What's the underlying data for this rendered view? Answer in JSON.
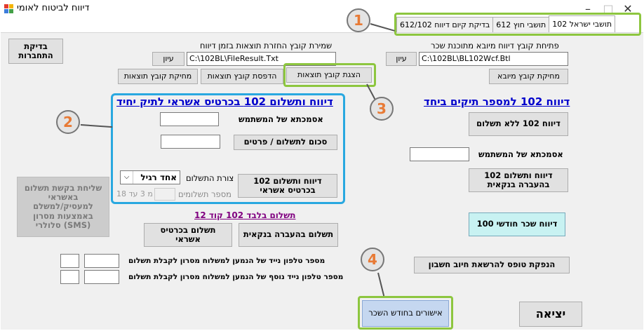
{
  "window": {
    "title": "דיווח לביטוח לאומי"
  },
  "tabs": [
    {
      "label": "612/102 בדיקת קיום דיווח",
      "active": false
    },
    {
      "label": "612 תושבי חוץ",
      "active": false
    },
    {
      "label": "102 תושבי ישראל",
      "active": true
    }
  ],
  "right_section": {
    "open_file_label": "פתיחת קובץ דיווח מיובא מתוכנת שכר",
    "open_file_path": "C:\\102BL\\BL102Wcf.Btl",
    "browse_label": "עיון",
    "delete_import_label": "מחיקת קובץ מיובא",
    "report_title": "דיווח 102 למספר תיקים ביחד",
    "report_no_payment": "דיווח 102 ללא תשלום",
    "user_ref_label": "אסמכתא של המשתמש",
    "user_ref_value": "",
    "report_bank_transfer": "דיווח ותשלום 102 בהעברה בנקאית",
    "monthly_salary": "דיווח שכר חודשי 100",
    "debit_form": "הנפקת טופס להרשאת חיוב חשבון"
  },
  "middle_section": {
    "save_results_label": "שמירת קובץ החזרת תוצאות בזמן דיווח",
    "save_results_path": "C:\\102BL\\FileResult.Txt",
    "browse_label": "עיון",
    "show_results": "הצגת קובץ תוצאות",
    "print_results": "הדפסת קובץ תוצאות",
    "delete_results": "מחיקת קובץ תוצאות",
    "credit_title": "דיווח ותשלום 102 בכרטיס אשראי לתיק יחיד",
    "user_ref_label": "אסמכתא של המשתמש",
    "user_ref_value": "",
    "amount_button": "סכום לתשלום / פרטים",
    "amount_value": "",
    "credit_report_button": "דיווח ותשלום 102 בכרטיס אשראי",
    "payment_form_label": "צורת התשלום",
    "payment_form_value": "אחד רגיל",
    "payments_count_label": "מספר תשלומים",
    "payments_range": "מ 3 עד 18",
    "payment_only_title": "תשלום בלבד 102 קוד 12",
    "pay_bank": "תשלום בהעברה בנקאית",
    "pay_credit": "תשלום בכרטיס אשראי",
    "phone_label_1": "מספר טלפון נייד של הנמען למשלוח מסרון לקבלת תשלום",
    "phone_label_2": "מספר טלפון נייד נוסף של הנמען למשלוח מסרון לקבלת תשלום"
  },
  "left_section": {
    "check_connection": "בדיקת התחברות",
    "sms_request": "שליחת בקשת תשלום באשראי למעסיק/למשלם באמצעות מסרון סלולרי (SMS)"
  },
  "bottom": {
    "monthly_approvals": "אישורים בחודש השכר",
    "exit": "יציאה"
  },
  "callouts": [
    "1",
    "2",
    "3",
    "4"
  ],
  "colors": {
    "highlight_green": "#8dc63f",
    "highlight_blue": "#29a8e0",
    "link_blue": "#0000cc",
    "link_purple": "#800080"
  }
}
